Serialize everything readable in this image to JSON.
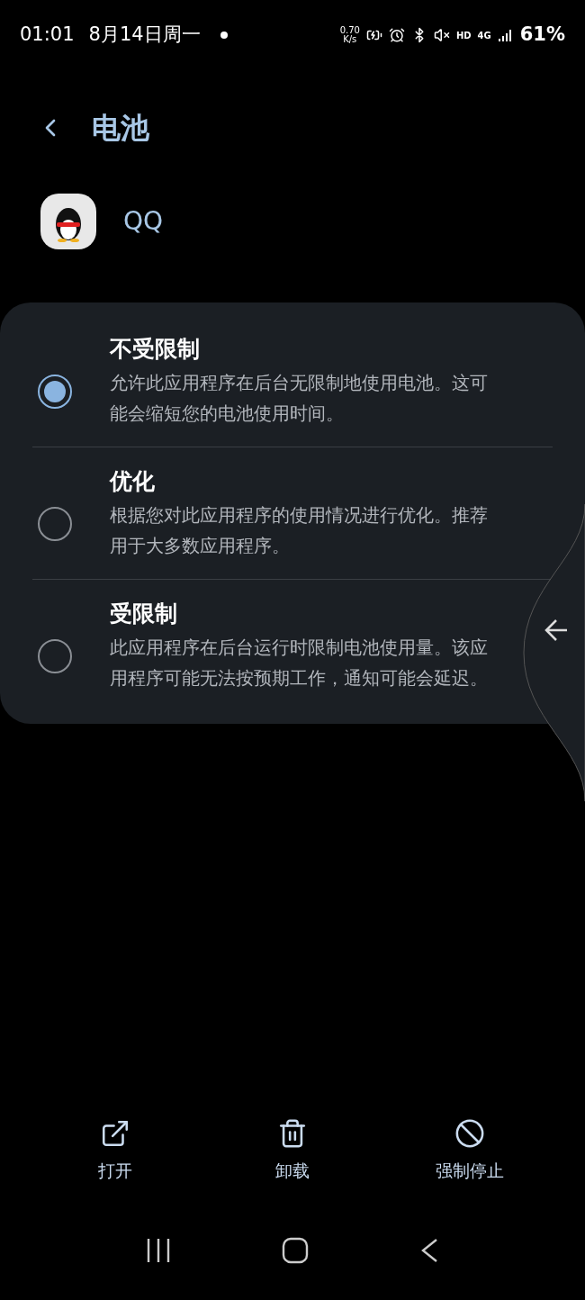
{
  "status_bar": {
    "time": "01:01",
    "date": "8月14日周一",
    "net_speed_value": "0.70",
    "net_speed_unit": "K/s",
    "network_hd": "HD",
    "network_type": "4G",
    "battery": "61%"
  },
  "header": {
    "title": "电池"
  },
  "app": {
    "name": "QQ"
  },
  "options": [
    {
      "title": "不受限制",
      "description": "允许此应用程序在后台无限制地使用电池。这可能会缩短您的电池使用时间。",
      "selected": true
    },
    {
      "title": "优化",
      "description": "根据您对此应用程序的使用情况进行优化。推荐用于大多数应用程序。",
      "selected": false
    },
    {
      "title": "受限制",
      "description": "此应用程序在后台运行时限制电池使用量。该应用程序可能无法按预期工作，通知可能会延迟。",
      "selected": false
    }
  ],
  "actions": [
    {
      "label": "打开",
      "kind": "open"
    },
    {
      "label": "卸载",
      "kind": "uninstall"
    },
    {
      "label": "强制停止",
      "kind": "stop"
    }
  ]
}
